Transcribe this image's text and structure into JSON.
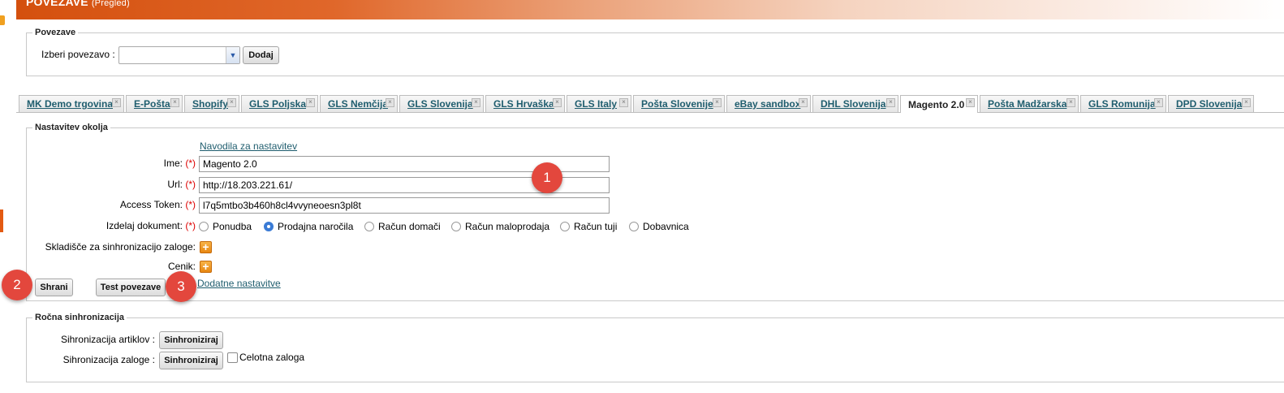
{
  "header": {
    "title": "POVEZAVE",
    "subtitle": "(Pregled)"
  },
  "povezave": {
    "legend": "Povezave",
    "select_label": "Izberi povezavo :",
    "select_value": "",
    "add_button": "Dodaj"
  },
  "tabs": [
    {
      "label": "MK Demo trgovina",
      "active": false
    },
    {
      "label": "E-Pošta",
      "active": false
    },
    {
      "label": "Shopify",
      "active": false
    },
    {
      "label": "GLS Poljska",
      "active": false
    },
    {
      "label": "GLS Nemčija",
      "active": false
    },
    {
      "label": "GLS Slovenija",
      "active": false
    },
    {
      "label": "GLS Hrvaška",
      "active": false
    },
    {
      "label": "GLS Italy",
      "active": false
    },
    {
      "label": "Pošta Slovenije",
      "active": false
    },
    {
      "label": "eBay sandbox",
      "active": false
    },
    {
      "label": "DHL Slovenija",
      "active": false
    },
    {
      "label": "Magento 2.0",
      "active": true
    },
    {
      "label": "Pošta Madžarska",
      "active": false
    },
    {
      "label": "GLS Romunija",
      "active": false
    },
    {
      "label": "DPD Slovenija",
      "active": false
    }
  ],
  "tab_close_glyph": "×",
  "settings": {
    "legend": "Nastavitev okolja",
    "help_link": "Navodila za nastavitev",
    "required_marker": "(*)",
    "name_label": "Ime:",
    "name_value": "Magento 2.0",
    "url_label": "Url:",
    "url_value": "http://18.203.221.61/",
    "token_label": "Access Token:",
    "token_value": "l7q5mtbo3b460h8cl4vvyneoesn3pl8t",
    "document_label": "Izdelaj dokument:",
    "document_options": [
      {
        "label": "Ponudba",
        "selected": false
      },
      {
        "label": "Prodajna naročila",
        "selected": true
      },
      {
        "label": "Račun domači",
        "selected": false
      },
      {
        "label": "Račun maloprodaja",
        "selected": false
      },
      {
        "label": "Račun tuji",
        "selected": false
      },
      {
        "label": "Dobavnica",
        "selected": false
      }
    ],
    "warehouse_label": "Skladišče za sinhronizacijo zaloge:",
    "pricelist_label": "Cenik:",
    "save_button": "Shrani",
    "test_button": "Test povezave",
    "extra_link": "Dodatne nastavitve"
  },
  "sync": {
    "legend": "Ročna sinhronizacija",
    "articles_label": "Sihronizacija artiklov :",
    "stock_label": "Sihronizacija zaloge :",
    "sync_button": "Sinhroniziraj",
    "full_stock_label": "Celotna zaloga"
  },
  "badges": [
    "1",
    "2",
    "3"
  ],
  "colors": {
    "accent": "#e35a12",
    "badge": "#e3473d",
    "link": "#1f5d6e"
  }
}
